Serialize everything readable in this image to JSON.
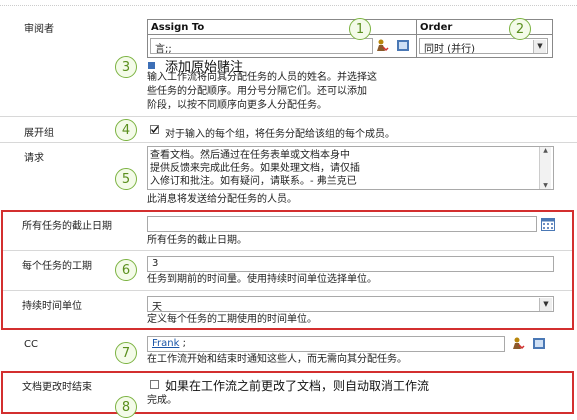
{
  "approvers": {
    "label": "审阅者",
    "col_assign_to": "Assign To",
    "col_order": "Order",
    "assign_value": "言;;",
    "order_value": "同时 (并行)",
    "add_text": "添加原始赌注",
    "desc": [
      "输入工作流将向其分配任务的人员的姓名。并选择这",
      "些任务的分配顺序。用分号分隔它们。还可以添加",
      "阶段，以按不同顺序向更多人分配任务。"
    ]
  },
  "expand_groups": {
    "label": "展开组",
    "checkbox_text": "对于输入的每个组，将任务分配给该组的每个成员。"
  },
  "request": {
    "label": "请求",
    "text": [
      "查看文档。然后通过在任务表单或文档本身中",
      "提供反馈来完成此任务。如果处理文档，请仅插",
      "入修订和批注。如有疑问，请联系。- 弗兰克已"
    ],
    "desc": "此消息将发送给分配任务的人员。"
  },
  "due_date": {
    "label": "所有任务的截止日期",
    "desc": "所有任务的截止日期。"
  },
  "duration": {
    "label": "每个任务的工期",
    "value": "3",
    "desc": "任务到期前的时间量。使用持续时间单位选择单位。"
  },
  "duration_units": {
    "label": "持续时间单位",
    "value": "天",
    "desc": "定义每个任务的工期使用的时间单位。"
  },
  "cc": {
    "label": "CC",
    "value": "Frank",
    "value_suffix": " ;",
    "desc": "在工作流开始和结束时通知这些人，而无需向其分配任务。"
  },
  "end_on_change": {
    "label": "文档更改时结束",
    "checkbox_text": "如果在工作流之前更改了文档，则自动取消工作流",
    "desc": "完成。"
  },
  "callouts": [
    "1",
    "2",
    "3",
    "4",
    "5",
    "6",
    "7",
    "8"
  ],
  "colors": {
    "callout_border": "#7cb342",
    "red_box": "#d32f2f",
    "link_blue": "#1a56a8"
  }
}
